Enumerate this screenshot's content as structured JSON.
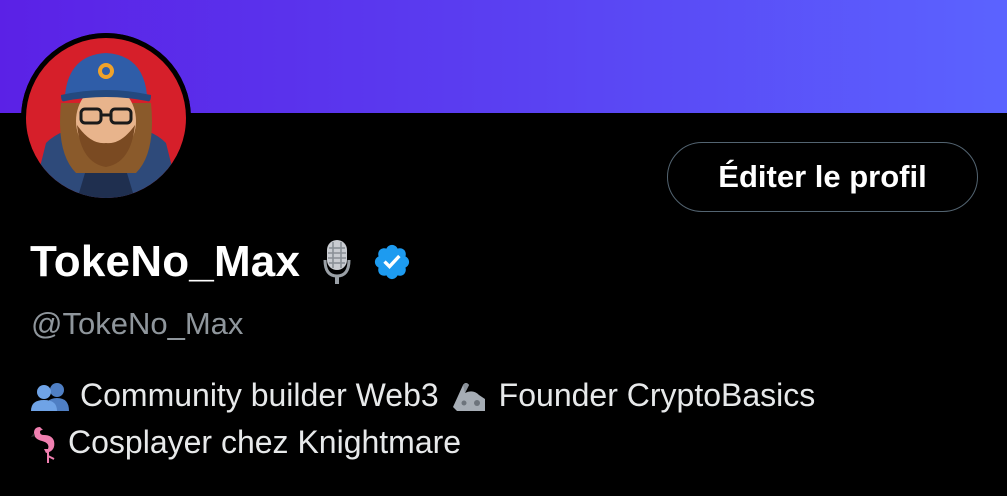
{
  "profile": {
    "display_name": "TokeNo_Max",
    "handle": "@TokeNo_Max",
    "edit_button_label": "Éditer le profil",
    "name_emoji": "microphone-icon",
    "verified": true
  },
  "bio": {
    "line1_part1": "Community builder Web3",
    "line1_part2": "Founder CryptoBasics",
    "line2": "Cosplayer chez Knightmare",
    "emojis": [
      "busts-in-silhouette-icon",
      "mechanical-arm-icon",
      "flamingo-icon"
    ]
  },
  "colors": {
    "background": "#000000",
    "banner_start": "#5b21e6",
    "banner_end": "#5b63ff",
    "verified_blue": "#1d9bf0",
    "handle_gray": "#8f969c"
  }
}
